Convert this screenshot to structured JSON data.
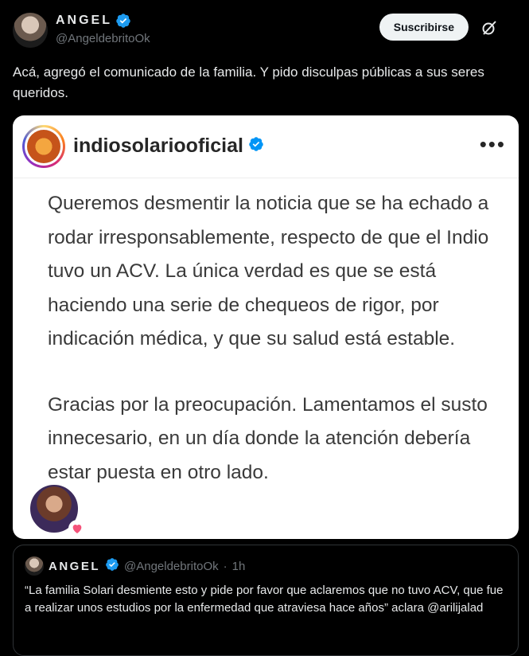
{
  "author": {
    "name": "ANGEL",
    "handle": "@AngeldebritoOk"
  },
  "actions": {
    "subscribe_label": "Suscribirse",
    "grok_icon": "grok-slash-icon"
  },
  "tweet": {
    "text": "Acá, agregó el comunicado de la familia. Y pido disculpas públicas a sus seres queridos."
  },
  "media": {
    "ig_username": "indiosolariooficial",
    "paragraph1": "Queremos desmentir la noticia que se ha echado a rodar irresponsablemente, respecto de que el Indio tuvo un ACV. La única verdad es que se está haciendo una serie de chequeos de rigor, por indicación médica, y que su salud está estable.",
    "paragraph2": "Gracias por la preocupación. Lamentamos el susto innecesario, en un día donde la atención debería estar puesta en otro lado."
  },
  "quote": {
    "name": "ANGEL",
    "handle": "@AngeldebritoOk",
    "separator": "·",
    "time": "1h",
    "text": "“La familia Solari desmiente esto y pide por favor que aclaremos que no tuvo ACV, que fue a realizar unos estudios por la enfermedad que atraviesa hace años” aclara @arilijalad"
  },
  "colors": {
    "background": "#000000",
    "verified": "#1d9bf0",
    "text_primary": "#e7e9ea",
    "text_secondary": "#71767b"
  }
}
